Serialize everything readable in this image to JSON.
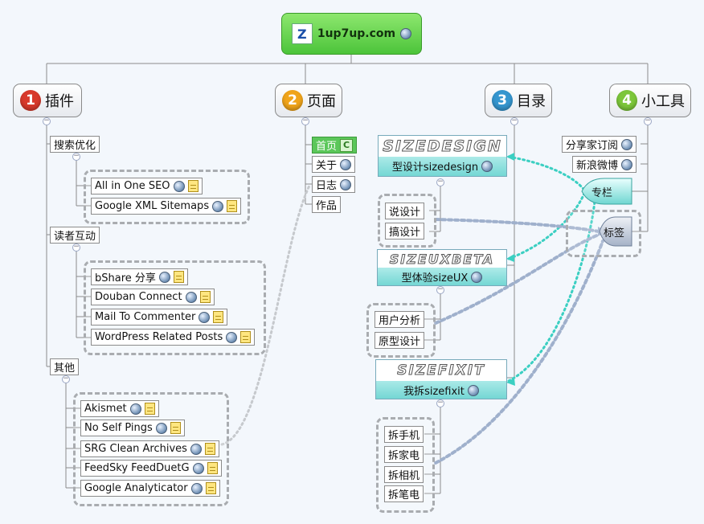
{
  "root": {
    "title": "1up7up.com",
    "logo": "Z"
  },
  "branches": [
    {
      "num": "1",
      "label": "插件",
      "color": "#d8392b"
    },
    {
      "num": "2",
      "label": "页面",
      "color": "#f0a41a"
    },
    {
      "num": "3",
      "label": "目录",
      "color": "#3596cf"
    },
    {
      "num": "4",
      "label": "小工具",
      "color": "#7cc63a"
    }
  ],
  "plugins": {
    "seo": {
      "label": "搜索优化",
      "items": [
        "All in One SEO",
        "Google XML Sitemaps"
      ]
    },
    "social": {
      "label": "读者互动",
      "items": [
        "bShare 分享",
        "Douban Connect",
        "Mail To Commenter",
        "WordPress Related Posts"
      ]
    },
    "other": {
      "label": "其他",
      "items": [
        "Akismet",
        "No Self Pings",
        "SRG Clean Archives",
        "FeedSky FeedDuetG",
        "Google Analyticator"
      ]
    }
  },
  "pages": {
    "items": [
      "首页",
      "关于",
      "日志",
      "作品"
    ],
    "badge": "C"
  },
  "categories": {
    "design": {
      "banner": "SIZEDESIGN",
      "caption": "型设计sizedesign",
      "items": [
        "说设计",
        "搞设计"
      ]
    },
    "ux": {
      "banner": "SIZEUXBETA",
      "caption": "型体验sizeUX",
      "items": [
        "用户分析",
        "原型设计"
      ]
    },
    "fixit": {
      "banner": "SIZEFIXIT",
      "caption": "我拆sizefixit",
      "items": [
        "拆手机",
        "拆家电",
        "拆相机",
        "拆笔电"
      ]
    }
  },
  "widgets": {
    "items": [
      "分享家订阅",
      "新浪微博"
    ],
    "column": "专栏",
    "tags": "标签"
  },
  "colors": {
    "root": "#4cc43a",
    "teal": "#3bcfc2",
    "link": "#9fb0cc",
    "selected": "#5bc75a"
  }
}
